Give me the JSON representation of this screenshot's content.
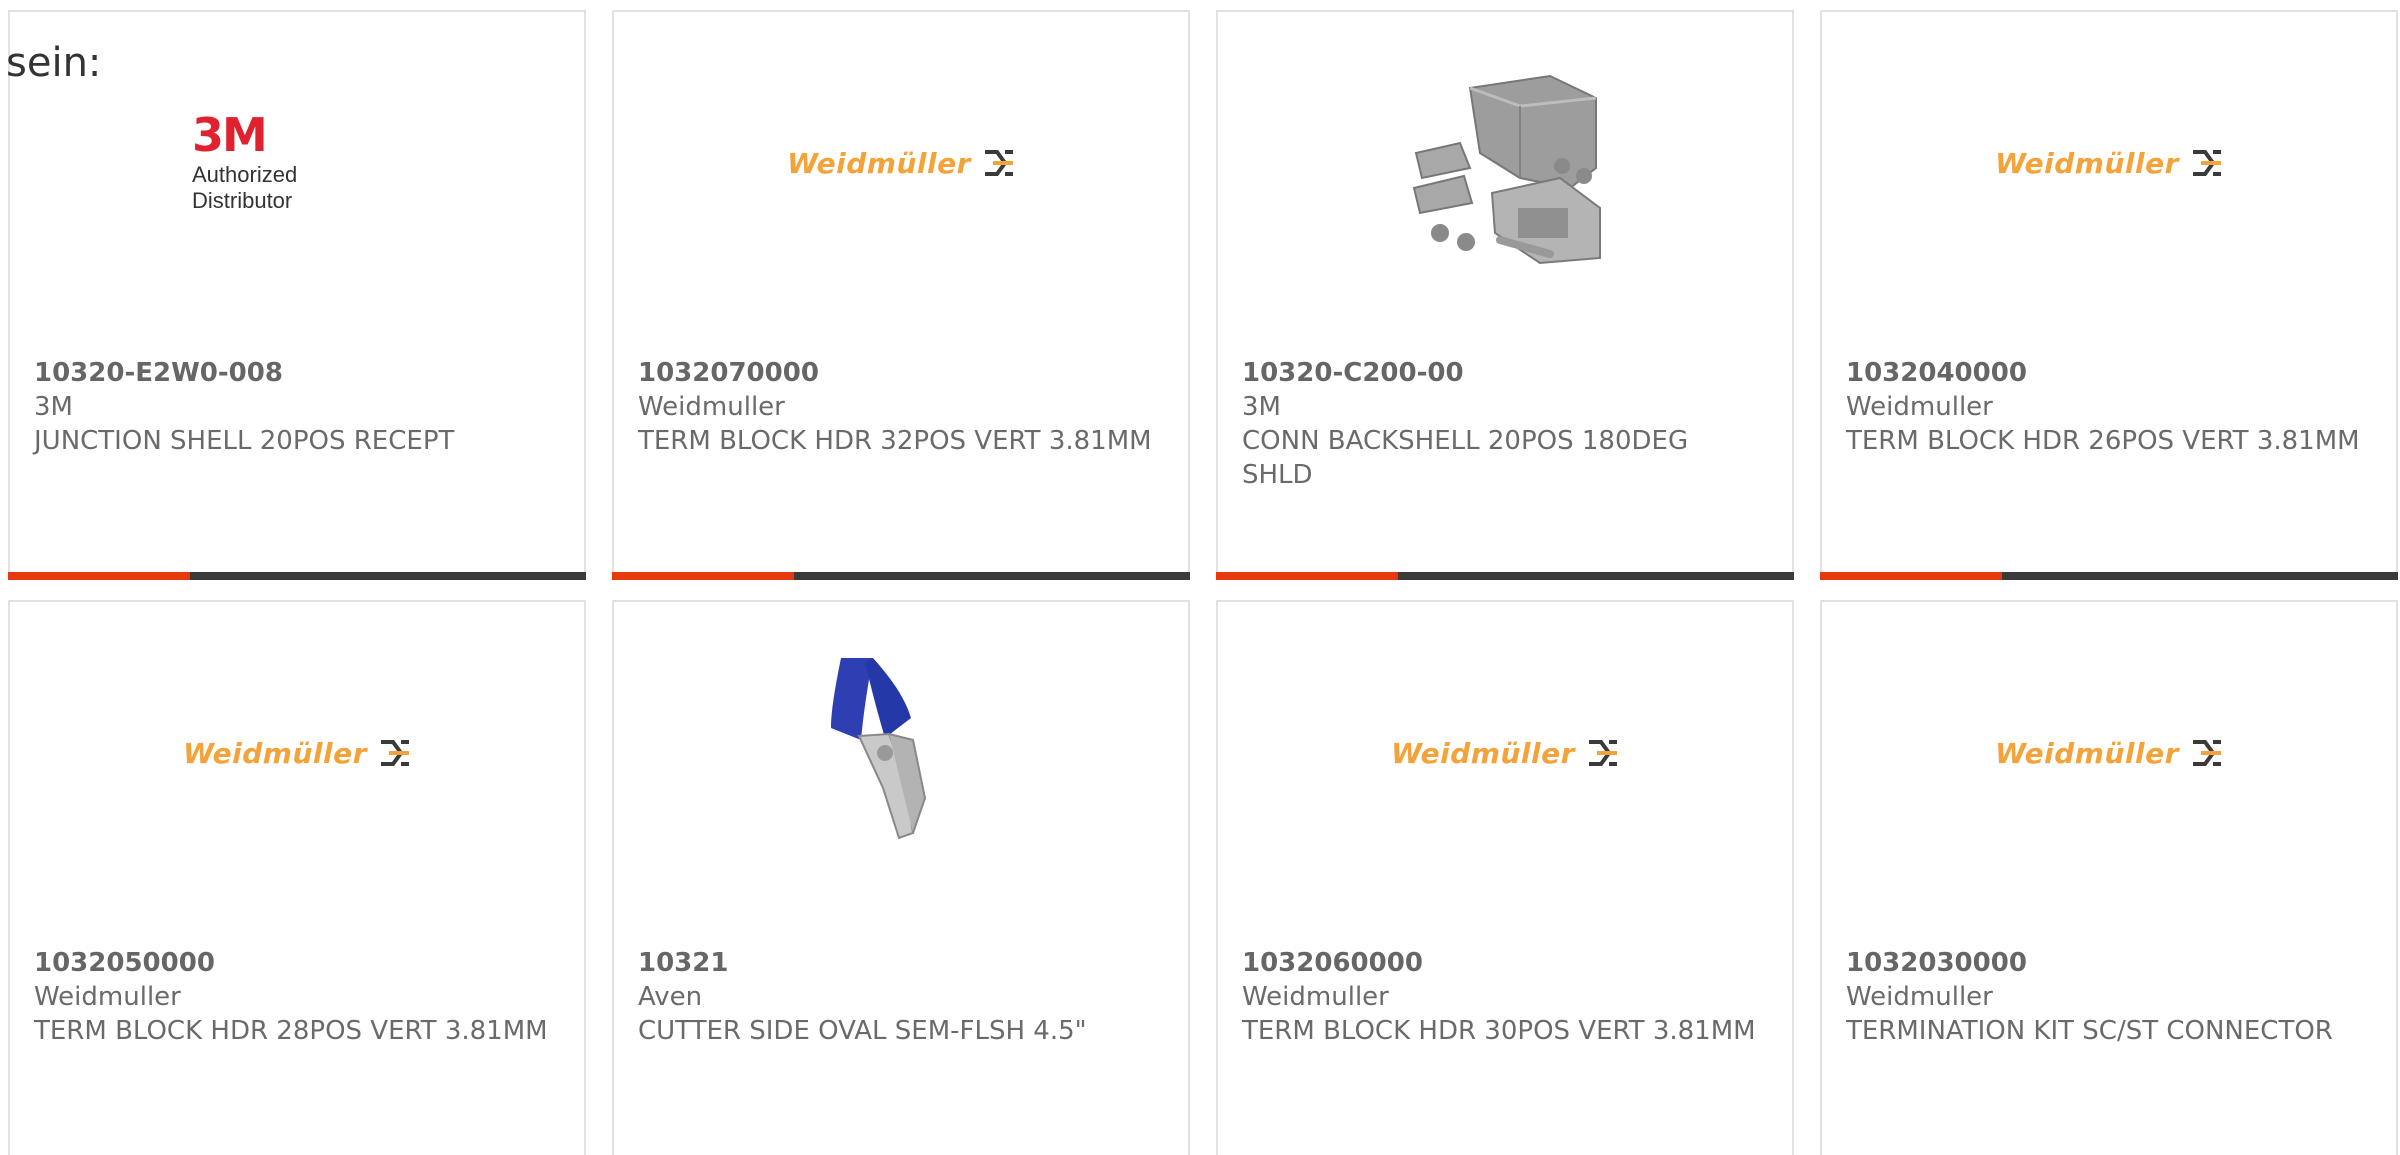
{
  "intro_text": "sein:",
  "colors": {
    "accent": "#e8380d",
    "bar": "#3b3b3b",
    "weidmuller_orange": "#f3a33a",
    "brand_3m_red": "#e0222e"
  },
  "products": [
    {
      "part_number": "10320-E2W0-008",
      "manufacturer": "3M",
      "description": "JUNCTION SHELL 20POS RECEPT",
      "image": "3m-authorized-distributor-logo",
      "logo_mark": "3M",
      "logo_sub": "Authorized Distributor"
    },
    {
      "part_number": "1032070000",
      "manufacturer": "Weidmuller",
      "description": "TERM BLOCK HDR 32POS VERT 3.81MM",
      "image": "weidmuller-logo",
      "logo_word": "Weidmüller"
    },
    {
      "part_number": "10320-C200-00",
      "manufacturer": "3M",
      "description": "CONN BACKSHELL 20POS 180DEG SHLD",
      "image": "backshell-product-photo"
    },
    {
      "part_number": "1032040000",
      "manufacturer": "Weidmuller",
      "description": "TERM BLOCK HDR 26POS VERT 3.81MM",
      "image": "weidmuller-logo",
      "logo_word": "Weidmüller"
    },
    {
      "part_number": "1032050000",
      "manufacturer": "Weidmuller",
      "description": "TERM BLOCK HDR 28POS VERT 3.81MM",
      "image": "weidmuller-logo",
      "logo_word": "Weidmüller"
    },
    {
      "part_number": "10321",
      "manufacturer": "Aven",
      "description": "CUTTER SIDE OVAL SEM-FLSH 4.5\"",
      "image": "side-cutter-photo"
    },
    {
      "part_number": "1032060000",
      "manufacturer": "Weidmuller",
      "description": "TERM BLOCK HDR 30POS VERT 3.81MM",
      "image": "weidmuller-logo",
      "logo_word": "Weidmüller"
    },
    {
      "part_number": "1032030000",
      "manufacturer": "Weidmuller",
      "description": "TERMINATION KIT SC/ST CONNECTOR",
      "image": "weidmuller-logo",
      "logo_word": "Weidmüller"
    }
  ]
}
